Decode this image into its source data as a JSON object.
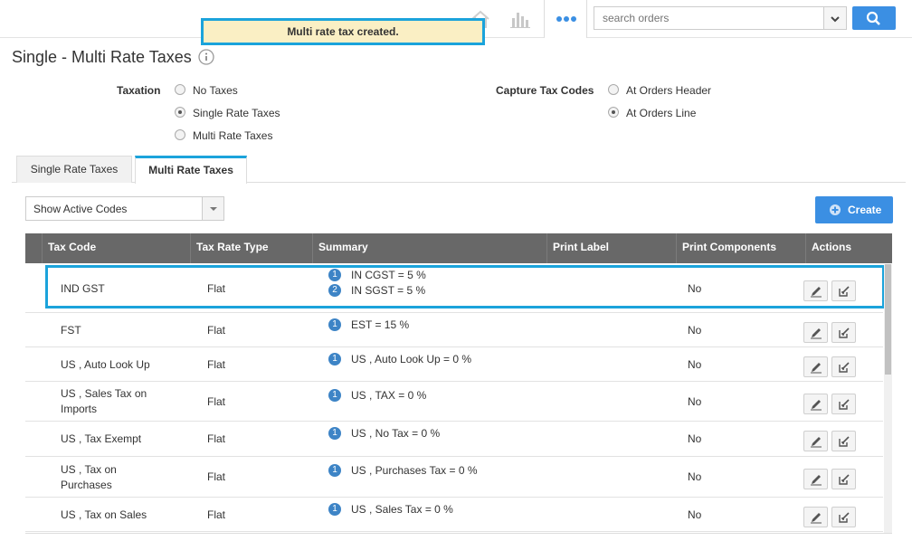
{
  "header": {
    "search_placeholder": "search orders",
    "notification": "Multi rate tax created."
  },
  "page": {
    "title": "Single - Multi Rate Taxes"
  },
  "taxation": {
    "label": "Taxation",
    "options": [
      "No Taxes",
      "Single Rate Taxes",
      "Multi Rate Taxes"
    ],
    "selected": "Single Rate Taxes"
  },
  "capture": {
    "label": "Capture Tax Codes",
    "options": [
      "At Orders Header",
      "At Orders Line"
    ],
    "selected": "At Orders Line"
  },
  "tabs": [
    "Single Rate Taxes",
    "Multi Rate Taxes"
  ],
  "active_tab": "Multi Rate Taxes",
  "filter": {
    "selected": "Show Active Codes"
  },
  "create_label": "Create",
  "table": {
    "columns": [
      "Tax Code",
      "Tax Rate Type",
      "Summary",
      "Print Label",
      "Print Components",
      "Actions"
    ],
    "rows": [
      {
        "code": "IND GST",
        "type": "Flat",
        "summary": [
          {
            "n": "1",
            "t": "IN CGST = 5 %"
          },
          {
            "n": "2",
            "t": "IN SGST = 5 %"
          }
        ],
        "label": "",
        "components": "No"
      },
      {
        "code": "FST",
        "type": "Flat",
        "summary": [
          {
            "n": "1",
            "t": "EST = 15 %"
          }
        ],
        "label": "",
        "components": "No"
      },
      {
        "code": "US , Auto Look Up",
        "type": "Flat",
        "summary": [
          {
            "n": "1",
            "t": "US , Auto Look Up = 0 %"
          }
        ],
        "label": "",
        "components": "No"
      },
      {
        "code": "US , Sales Tax on Imports",
        "type": "Flat",
        "summary": [
          {
            "n": "1",
            "t": "US , TAX = 0 %"
          }
        ],
        "label": "",
        "components": "No"
      },
      {
        "code": "US , Tax Exempt",
        "type": "Flat",
        "summary": [
          {
            "n": "1",
            "t": "US , No Tax = 0 %"
          }
        ],
        "label": "",
        "components": "No"
      },
      {
        "code": "US , Tax on Purchases",
        "type": "Flat",
        "summary": [
          {
            "n": "1",
            "t": "US , Purchases Tax = 0 %"
          }
        ],
        "label": "",
        "components": "No"
      },
      {
        "code": "US , Tax on Sales",
        "type": "Flat",
        "summary": [
          {
            "n": "1",
            "t": "US , Sales Tax = 0 %"
          }
        ],
        "label": "",
        "components": "No"
      }
    ]
  },
  "colors": {
    "accent": "#1ba3db",
    "primary_button": "#3b8fe3",
    "table_header": "#686868",
    "badge": "#3d84c6",
    "toast_bg": "#faefc4"
  },
  "icons": [
    "home-icon",
    "chart-icon",
    "more-dots-icon",
    "search-icon",
    "info-icon",
    "plus-circle-icon",
    "edit-pencil-icon",
    "edit-box-icon"
  ]
}
